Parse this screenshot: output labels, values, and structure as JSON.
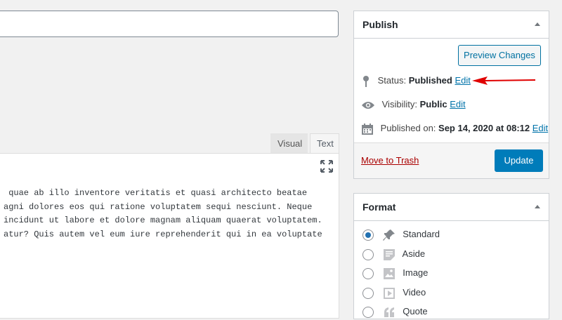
{
  "editor": {
    "tabs": [
      {
        "label": "Visual"
      },
      {
        "label": "Text"
      }
    ],
    "content_lines": [
      " quae ab illo inventore veritatis et quasi architecto beatae",
      "agni dolores eos qui ratione voluptatem sequi nesciunt. Neque",
      "incidunt ut labore et dolore magnam aliquam quaerat voluptatem.",
      "atur? Quis autem vel eum iure reprehenderit qui in ea voluptate"
    ]
  },
  "publish": {
    "title": "Publish",
    "preview_button": "Preview Changes",
    "status_label": "Status:",
    "status_value": "Published",
    "status_edit": "Edit",
    "visibility_label": "Visibility:",
    "visibility_value": "Public",
    "visibility_edit": "Edit",
    "published_label": "Published on:",
    "published_value": "Sep 14, 2020 at 08:12",
    "published_edit": "Edit",
    "trash_link": "Move to Trash",
    "update_button": "Update"
  },
  "format": {
    "title": "Format",
    "options": [
      {
        "label": "Standard",
        "icon": "pushpin-icon",
        "checked": true
      },
      {
        "label": "Aside",
        "icon": "aside-icon",
        "checked": false
      },
      {
        "label": "Image",
        "icon": "image-icon",
        "checked": false
      },
      {
        "label": "Video",
        "icon": "video-icon",
        "checked": false
      },
      {
        "label": "Quote",
        "icon": "quote-icon",
        "checked": false
      }
    ]
  },
  "colors": {
    "accent": "#007cba",
    "link": "#0073aa",
    "danger": "#a00",
    "annotation_arrow": "#e00000"
  }
}
